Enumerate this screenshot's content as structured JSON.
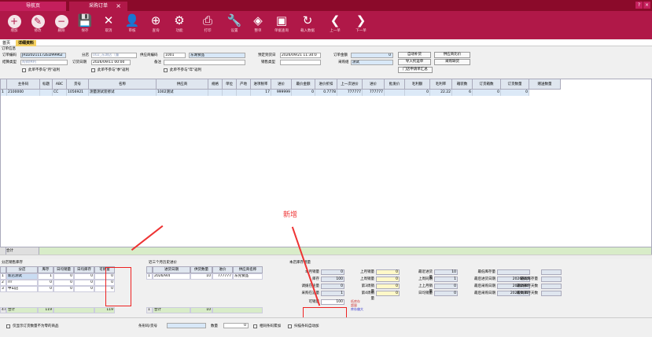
{
  "tabs": {
    "nav": "导航页",
    "order": "采购订单",
    "close": "×"
  },
  "window_buttons": [
    "?",
    "×"
  ],
  "toolbar": [
    {
      "icon": "plus-icon",
      "label": "增加"
    },
    {
      "icon": "edit-icon",
      "label": "修改"
    },
    {
      "icon": "minus-icon",
      "label": "删除"
    },
    {
      "icon": "save-icon",
      "label": "保存"
    },
    {
      "icon": "cancel-icon",
      "label": "取消"
    },
    {
      "icon": "user-icon",
      "label": "审核"
    },
    {
      "icon": "zoom-icon",
      "label": "查询"
    },
    {
      "icon": "gear-icon",
      "label": "功能"
    },
    {
      "icon": "printer-icon",
      "label": "打印"
    },
    {
      "icon": "wrench-icon",
      "label": "设置"
    },
    {
      "icon": "layers-icon",
      "label": "整单"
    },
    {
      "icon": "query-icon",
      "label": "单据查询"
    },
    {
      "icon": "refresh-icon",
      "label": "载入数据"
    },
    {
      "icon": "prev-icon",
      "label": "上一单"
    },
    {
      "icon": "next-icon",
      "label": "下一单"
    }
  ],
  "subtabs": [
    "首页",
    "详细资料"
  ],
  "form": {
    "section_title": "订单信息",
    "order_no_label": "订单编码",
    "order_no": "JRD2021117ZED99962",
    "branch_label": "分店",
    "branch": "002_东湖店（董",
    "supplier_code_label": "供应商编码",
    "supplier_code": "1001",
    "supplier_name": "东湖食品",
    "arrival_label": "预定到货日",
    "arrival": "2026/09/21 11:30:0",
    "amount_label": "订单金额",
    "amount": "0",
    "settle_label": "结算类型",
    "settle": "购销供利",
    "order_date_label": "订货日期",
    "order_date": "2026/09/11 00:00",
    "remark_label": "备注",
    "remark": "",
    "sale_type_label": "销售类型",
    "sale_type": "",
    "buyer_label": "采购组",
    "buyer": "测试",
    "btn_auto": "自动补货",
    "btn_compare": "供应商比价",
    "btn_import": "导入托运单",
    "btn_shortage": "采购缺货",
    "btn_store_req": "门店申请单汇总",
    "chk1": "此单不参与\"月\"返利",
    "chk2": "此单不参与\"季\"返利",
    "chk3": "此单不参与\"年\"返利"
  },
  "grid": {
    "headers": [
      "主条码",
      "标题",
      "ABC",
      "货号",
      "名称",
      "供应商",
      "规格",
      "单位",
      "产地",
      "进项税率",
      "进价",
      "最价金额",
      "进价折扣",
      "上一次进价",
      "进价",
      "批发价",
      "毛利额",
      "毛利率",
      "箱装数",
      "订货箱数",
      "订货数量",
      "赠送数量"
    ],
    "row": [
      "1",
      "2100000",
      "",
      "CC",
      "1056921",
      "测量测试装修试",
      "1002测试",
      "",
      "",
      "",
      "17",
      "999999",
      "0",
      "0.7778",
      "777777",
      "777777",
      "",
      "0",
      "22.22",
      "6",
      "0",
      "0"
    ],
    "sum_label": "合计",
    "sum_row_no": "1",
    "sum_values": [
      "0",
      "0",
      "0",
      "0",
      "0"
    ]
  },
  "stock_panel": {
    "title": "分店销售库存",
    "headers": [
      "分店",
      "库存",
      "日均销量",
      "日均库存",
      "可销量"
    ],
    "rows": [
      {
        "no": "1",
        "name": "新店测试",
        "stock": "1",
        "daily": "0",
        "daily_stock": "0",
        "avail": "0",
        "selected": true
      },
      {
        "no": "2",
        "name": "rrr",
        "stock": "0",
        "daily": "0",
        "daily_stock": "0",
        "avail": "0",
        "selected": false
      },
      {
        "no": "3",
        "name": "中山店",
        "stock": "0",
        "daily": "0",
        "daily_stock": "0",
        "avail": "0",
        "selected": false
      }
    ],
    "sum_no": "47",
    "sum_label": "合计",
    "sum_stock": "119",
    "sum_avail": "119"
  },
  "history_panel": {
    "title": "近三个月历史进价",
    "headers": [
      "进货日期",
      "供货数量",
      "进价",
      "供应商名称"
    ],
    "rows": [
      {
        "no": "1",
        "date": "2026/9/4",
        "qty": "10",
        "price": "777777",
        "supplier": "东莞食品"
      }
    ],
    "sum_no": "1",
    "sum_label": "合计",
    "sum_qty": "10"
  },
  "sales_panel": {
    "title": "本店库存销量",
    "items": [
      {
        "label": "本月销量",
        "value": "0"
      },
      {
        "label": "上月销量",
        "value": "0"
      },
      {
        "label": "最近进货量",
        "value": "10"
      },
      {
        "label": "最低库存量",
        "value": ""
      },
      {
        "label": "库存",
        "value": "100"
      },
      {
        "label": "上周销量",
        "value": "0"
      },
      {
        "label": "上周同期",
        "value": "1"
      },
      {
        "label": "最后进货日期",
        "value": "2026/9/4"
      },
      {
        "label": "调拨在途量",
        "value": "0"
      },
      {
        "label": "第3周销量",
        "value": "0"
      },
      {
        "label": "上上月销量",
        "value": "0"
      },
      {
        "label": "最后采购日期",
        "value": "2026/9/4"
      },
      {
        "label": "采购在途量",
        "value": "1"
      },
      {
        "label": "第4周销量",
        "value": "0"
      },
      {
        "label": "日均销量",
        "value": "0"
      },
      {
        "label": "最后采购日期",
        "value": "2026/9/31"
      }
    ],
    "col_labels": [
      "今日销量",
      "本周销量",
      "本月销量",
      "最低进货量",
      "最高库存量"
    ],
    "side_labels": [
      "最高库存量",
      "最高库存天数",
      "最高库存天数"
    ],
    "avail_label": "可销量",
    "avail_value": "100",
    "legend": [
      "低库存",
      "超量",
      "库存偏大"
    ]
  },
  "annotation": {
    "text": "新增"
  },
  "statusbar": {
    "chk_zero": "仅显示订货数量不为零的商品",
    "barcode_label": "条形码/货号",
    "barcode": "",
    "qty_label": "数量",
    "qty": "0",
    "chk_add": "相同条码累加",
    "chk_scan": "扫描条码自动加"
  },
  "colors": {
    "brand": "#b01848",
    "tabbar": "#8b0a2a",
    "header": "#dfe6ef",
    "row": "#dce9f7",
    "annotation": "#e22"
  }
}
